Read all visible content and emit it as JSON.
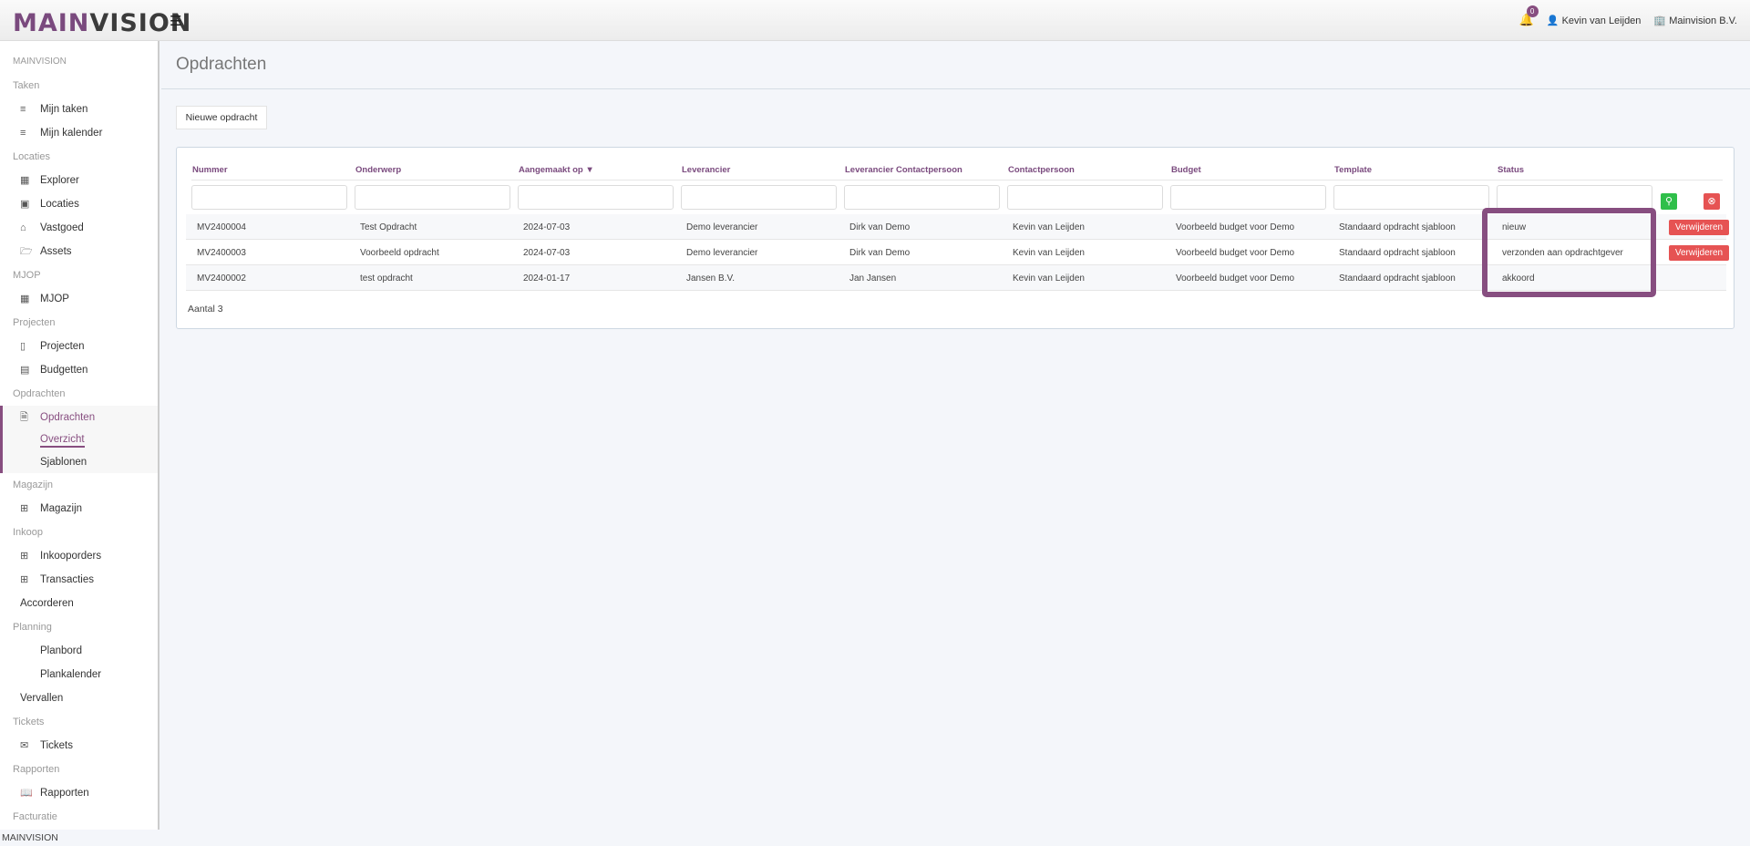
{
  "header": {
    "logo_a": "MAIN",
    "logo_b": "VISION",
    "menu_icon": "hamburger-icon",
    "notifications": "0",
    "user": "Kevin van Leijden",
    "company": "Mainvision B.V."
  },
  "sidebar": {
    "brand": "MAINVISION",
    "sections": {
      "taken": "Taken",
      "locaties": "Locaties",
      "mjop": "MJOP",
      "projecten": "Projecten",
      "opdrachten": "Opdrachten",
      "magazijn": "Magazijn",
      "inkoop": "Inkoop",
      "planning": "Planning",
      "tickets": "Tickets",
      "rapporten": "Rapporten",
      "facturatie": "Facturatie"
    },
    "items": {
      "mijn_taken": "Mijn taken",
      "mijn_kalender": "Mijn kalender",
      "explorer": "Explorer",
      "locaties": "Locaties",
      "vastgoed": "Vastgoed",
      "assets": "Assets",
      "mjop": "MJOP",
      "projecten": "Projecten",
      "budgetten": "Budgetten",
      "opdrachten": "Opdrachten",
      "overzicht": "Overzicht",
      "sjablonen": "Sjablonen",
      "magazijn": "Magazijn",
      "inkooporders": "Inkooporders",
      "transacties": "Transacties",
      "accorderen": "Accorderen",
      "planbord": "Planbord",
      "plankalender": "Plankalender",
      "vervallen": "Vervallen",
      "tickets": "Tickets",
      "rapporten": "Rapporten"
    }
  },
  "main": {
    "title": "Opdrachten",
    "new_button": "Nieuwe opdracht",
    "table": {
      "columns": [
        "Nummer",
        "Onderwerp",
        "Aangemaakt op ▼",
        "Leverancier",
        "Leverancier Contactpersoon",
        "Contactpersoon",
        "Budget",
        "Template",
        "Status"
      ],
      "rows": [
        [
          "MV2400004",
          "Test Opdracht",
          "2024-07-03",
          "Demo leverancier",
          "Dirk van Demo",
          "Kevin van Leijden",
          "Voorbeeld budget voor Demo",
          "Standaard opdracht sjabloon",
          "nieuw"
        ],
        [
          "MV2400003",
          "Voorbeeld opdracht",
          "2024-07-03",
          "Demo leverancier",
          "Dirk van Demo",
          "Kevin van Leijden",
          "Voorbeeld budget voor Demo",
          "Standaard opdracht sjabloon",
          "verzonden aan opdrachtgever"
        ],
        [
          "MV2400002",
          "test opdracht",
          "2024-01-17",
          "Jansen B.V.",
          "Jan Jansen",
          "Kevin van Leijden",
          "Voorbeeld budget voor Demo",
          "Standaard opdracht sjabloon",
          "akkoord"
        ]
      ],
      "delete_label": "Verwijderen",
      "count": "Aantal 3"
    }
  },
  "footer": "MAINVISION",
  "colors": {
    "accent": "#874e80",
    "danger": "#e65353",
    "success": "#2fbf4a"
  }
}
